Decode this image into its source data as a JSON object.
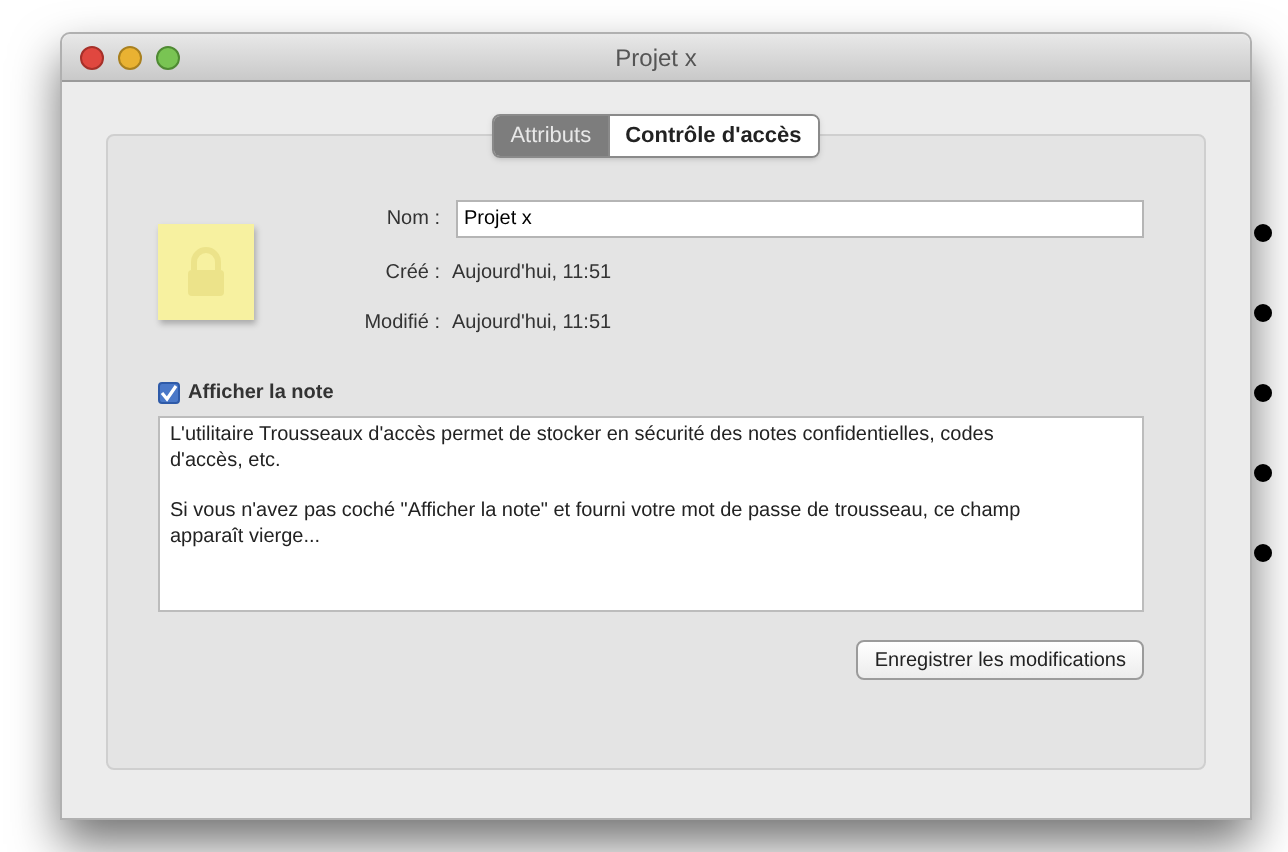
{
  "window": {
    "title": "Projet x"
  },
  "tabs": [
    {
      "label": "Attributs",
      "selected": true
    },
    {
      "label": "Contrôle d'accès",
      "selected": false
    }
  ],
  "fields": {
    "name": {
      "label": "Nom :",
      "value": "Projet x"
    },
    "info": [
      {
        "label": "Créé :",
        "value": "Aujourd'hui, 11:51"
      },
      {
        "label": "Modifié :",
        "value": "Aujourd'hui, 11:51"
      }
    ]
  },
  "show_note": {
    "label": "Afficher la note",
    "checked": true
  },
  "note": [
    "L'utilitaire Trousseaux d'accès permet de stocker en sécurité des notes confidentielles, codes d'accès, etc.",
    "Si vous n'avez pas coché \"Afficher la note\" et fourni votre mot de passe de trousseau, ce champ apparaît vierge..."
  ],
  "save_button": "Enregistrer les modifications"
}
